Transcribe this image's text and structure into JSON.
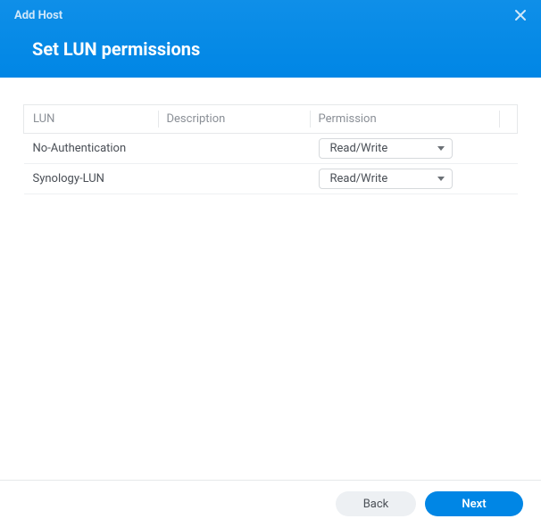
{
  "header": {
    "window_title": "Add Host"
  },
  "page": {
    "title": "Set LUN permissions"
  },
  "table": {
    "columns": {
      "lun": "LUN",
      "description": "Description",
      "permission": "Permission"
    },
    "rows": [
      {
        "lun": "No-Authentication",
        "description": "",
        "permission": "Read/Write"
      },
      {
        "lun": "Synology-LUN",
        "description": "",
        "permission": "Read/Write"
      }
    ]
  },
  "footer": {
    "back_label": "Back",
    "next_label": "Next"
  }
}
